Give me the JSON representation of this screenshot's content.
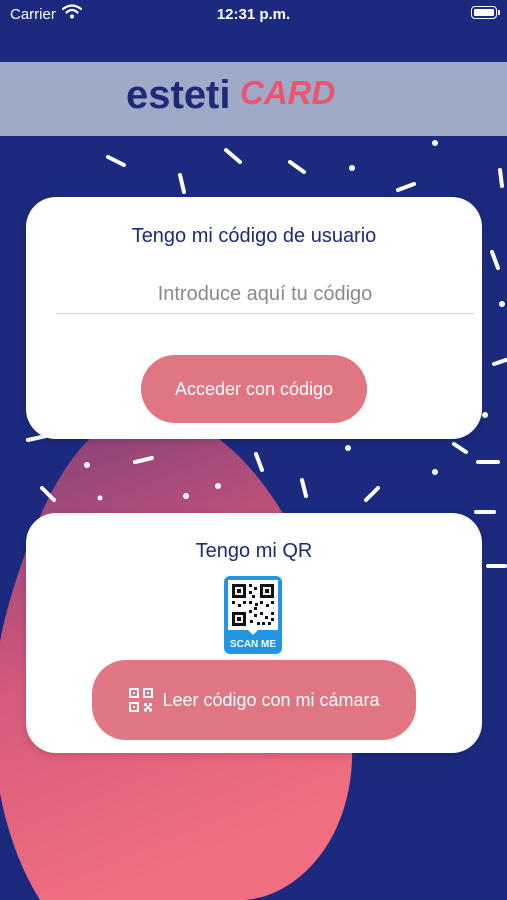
{
  "status_bar": {
    "carrier": "Carrier",
    "time": "12:31 p.m."
  },
  "logo": {
    "text_part1": "esteti",
    "text_part2": "CARD"
  },
  "code_card": {
    "title": "Tengo mi código de usuario",
    "input_placeholder": "Introduce aquí tu código",
    "input_value": "",
    "button_label": "Acceder con código"
  },
  "qr_card": {
    "title": "Tengo mi QR",
    "badge_label": "SCAN ME",
    "button_label": "Leer código con mi cámara"
  },
  "colors": {
    "background": "#1b2a7e",
    "header_band": "#9fa9c8",
    "accent_pink": "#e07583",
    "title_navy": "#1e2a78",
    "badge_blue": "#2196e3"
  },
  "icons": [
    "wifi-icon",
    "battery-icon",
    "qr-code-icon",
    "qr-scan-icon"
  ]
}
